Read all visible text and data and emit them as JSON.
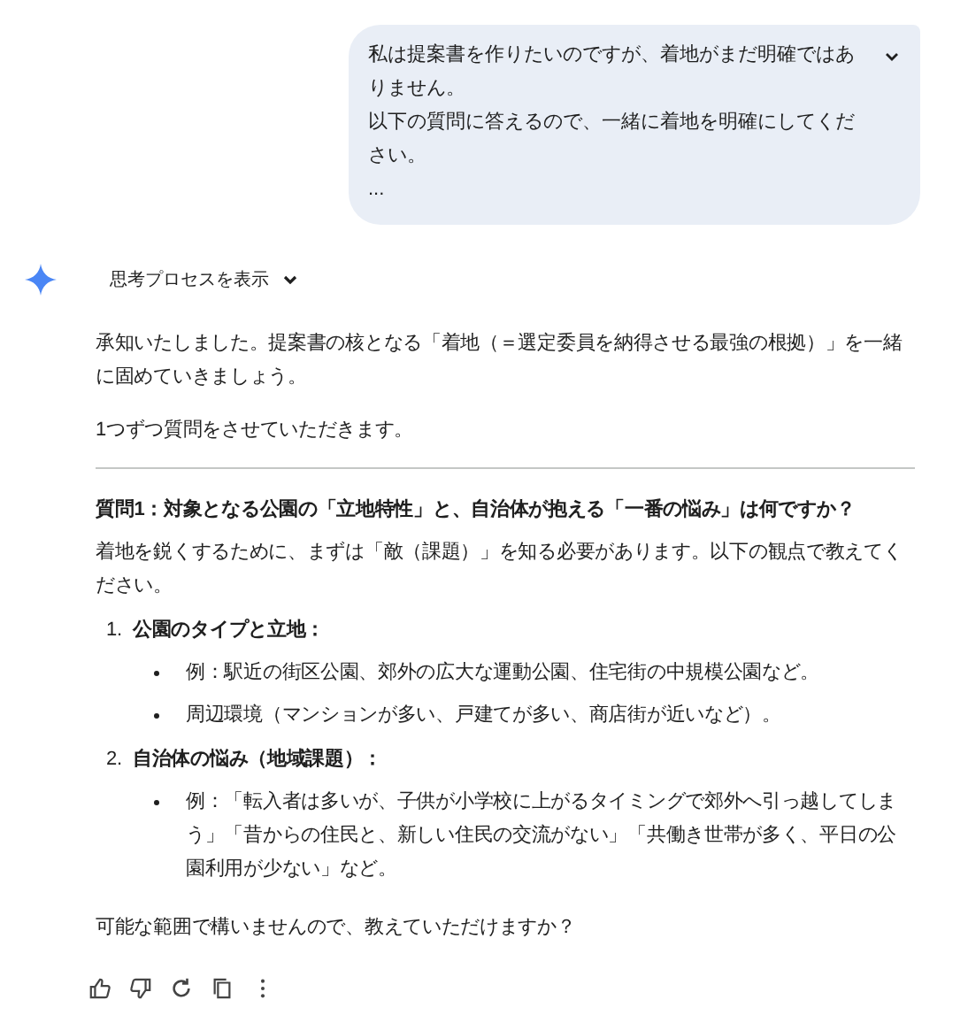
{
  "user_message": {
    "lines": [
      "私は提案書を作りたいのですが、着地がまだ明確ではありません。",
      "以下の質問に答えるので、一緒に着地を明確にしてください。",
      "..."
    ],
    "expanded": false
  },
  "thinking": {
    "label": "思考プロセスを表示",
    "expanded": false
  },
  "response": {
    "paragraphs": [
      "承知いたしました。提案書の核となる「着地（＝選定委員を納得させる最強の根拠）」を一緒に固めていきましょう。",
      "1つずつ質問をさせていただきます。"
    ],
    "question": {
      "heading": "質問1：対象となる公園の「立地特性」と、自治体が抱える「一番の悩み」は何ですか？",
      "intro": "着地を鋭くするために、まずは「敵（課題）」を知る必要があります。以下の観点で教えてください。",
      "items": [
        {
          "number": "1.",
          "title": "公園のタイプと立地：",
          "bullets": [
            "例：駅近の街区公園、郊外の広大な運動公園、住宅街の中規模公園など。",
            "周辺環境（マンションが多い、戸建てが多い、商店街が近いなど）。"
          ]
        },
        {
          "number": "2.",
          "title": "自治体の悩み（地域課題）：",
          "bullets": [
            "例：「転入者は多いが、子供が小学校に上がるタイミングで郊外へ引っ越してしまう」「昔からの住民と、新しい住民の交流がない」「共働き世帯が多く、平日の公園利用が少ない」など。"
          ]
        }
      ],
      "closing": "可能な範囲で構いませんので、教えていただけますか？"
    }
  }
}
